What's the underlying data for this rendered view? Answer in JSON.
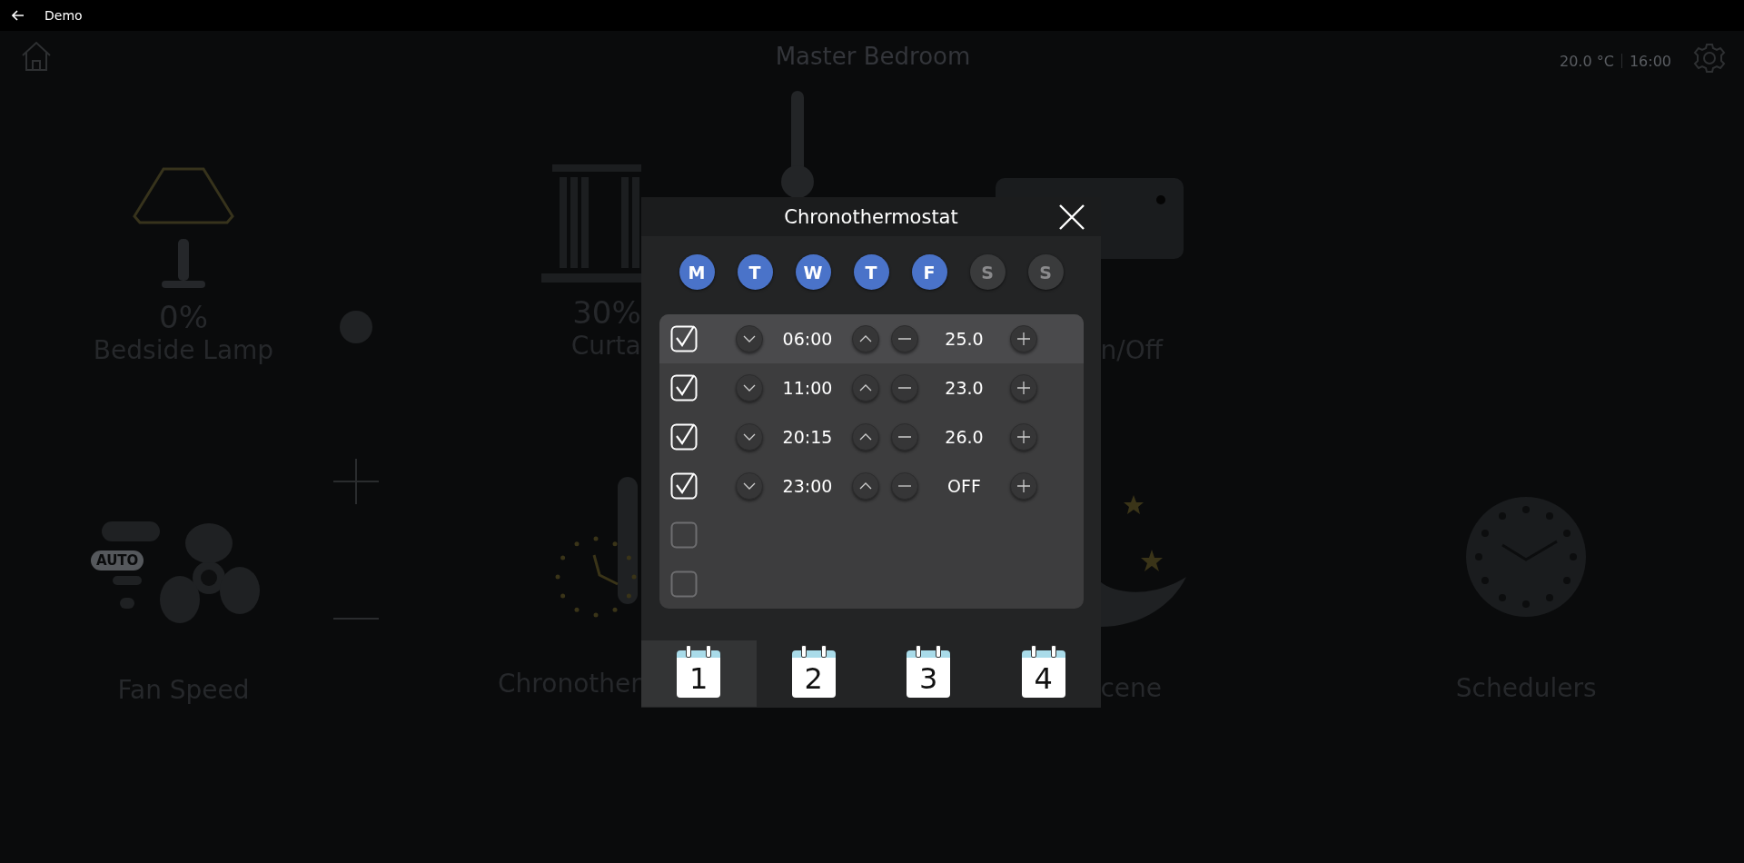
{
  "app_bar": {
    "title": "Demo"
  },
  "header": {
    "room": "Master Bedroom",
    "temperature": "20.0 °C",
    "time": "16:00"
  },
  "lamp": {
    "value": "0%",
    "label": "Bedside Lamp"
  },
  "curtains": {
    "value": "30%",
    "label": "Curta"
  },
  "on_off": {
    "label": "n/Off"
  },
  "fan": {
    "badge": "AUTO",
    "label": "Fan Speed"
  },
  "chronothermostat": {
    "label": "Chronother"
  },
  "scene": {
    "label": "cene"
  },
  "schedulers": {
    "label": "Schedulers"
  },
  "dialog": {
    "title": "Chronothermostat",
    "days": [
      {
        "label": "M",
        "selected": true
      },
      {
        "label": "T",
        "selected": true
      },
      {
        "label": "W",
        "selected": true
      },
      {
        "label": "T",
        "selected": true
      },
      {
        "label": "F",
        "selected": true
      },
      {
        "label": "S",
        "selected": false
      },
      {
        "label": "S",
        "selected": false
      }
    ],
    "rows": [
      {
        "checked": true,
        "selected": true,
        "time": "06:00",
        "setpoint": "25.0"
      },
      {
        "checked": true,
        "selected": false,
        "time": "11:00",
        "setpoint": "23.0"
      },
      {
        "checked": true,
        "selected": false,
        "time": "20:15",
        "setpoint": "26.0"
      },
      {
        "checked": true,
        "selected": false,
        "time": "23:00",
        "setpoint": "OFF"
      },
      {
        "checked": false,
        "selected": false
      },
      {
        "checked": false,
        "selected": false
      }
    ],
    "programs": [
      {
        "label": "1",
        "selected": true
      },
      {
        "label": "2",
        "selected": false
      },
      {
        "label": "3",
        "selected": false
      },
      {
        "label": "4",
        "selected": false
      }
    ]
  }
}
